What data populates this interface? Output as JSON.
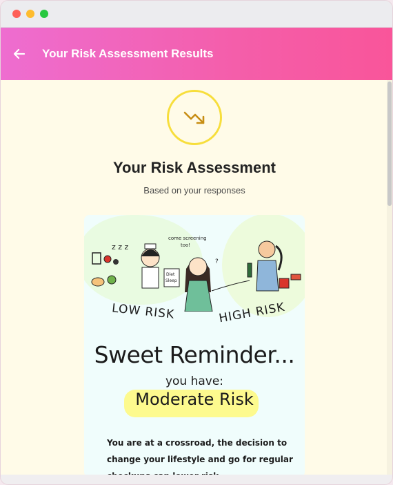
{
  "window": {
    "controls": [
      "close",
      "minimize",
      "maximize"
    ]
  },
  "header": {
    "back_icon": "arrow-left-icon",
    "title": "Your Risk Assessment Results"
  },
  "assessment": {
    "icon": "trending-down-icon",
    "title": "Your Risk Assessment",
    "subtitle": "Based on your responses"
  },
  "illustration": {
    "low_label": "LOW RISK",
    "high_label": "HIGH RISK",
    "bubble": "come screening too!",
    "sign": "Diet Sleep",
    "reminder": "Sweet Reminder...",
    "you_have": "you have:",
    "risk_level": "Moderate Risk",
    "message": "You are at a crossroad, the decision to change your lifestyle and go for regular checkups can lower risk"
  },
  "colors": {
    "accent_start": "#ee6dd0",
    "accent_end": "#f9559a",
    "ring": "#f7de3c",
    "highlight": "#fdfa8e"
  }
}
